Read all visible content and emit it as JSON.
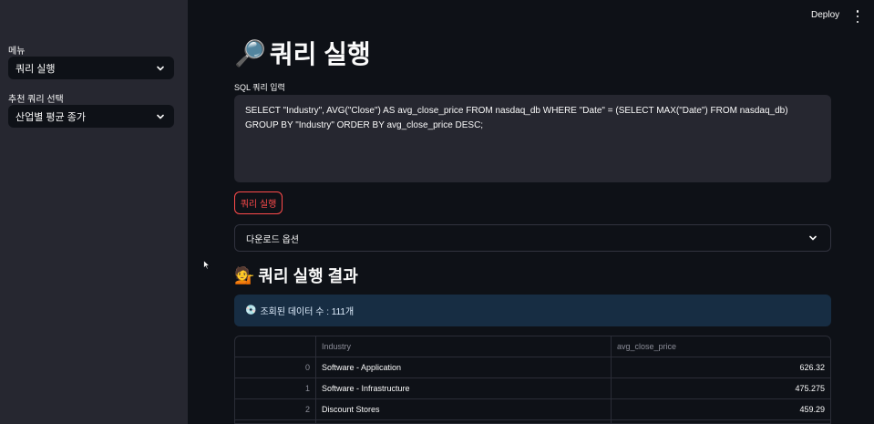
{
  "topbar": {
    "deploy_label": "Deploy"
  },
  "sidebar": {
    "menu_label": "메뉴",
    "menu_value": "쿼리 실행",
    "recommend_label": "추천 쿼리 선택",
    "recommend_value": "산업별 평균 종가"
  },
  "main": {
    "title_emoji": "🔎",
    "title": "쿼리 실행",
    "sql_label": "SQL 쿼리 입력",
    "sql_text": "SELECT \"Industry\", AVG(\"Close\") AS avg_close_price FROM nasdaq_db WHERE \"Date\" = (SELECT MAX(\"Date\") FROM nasdaq_db) GROUP BY \"Industry\" ORDER BY avg_close_price DESC;",
    "run_button": "쿼리 실행",
    "download_expander": "다운로드 옵션",
    "result_emoji": "💁",
    "result_title": "쿼리 실행 결과",
    "info_emoji": "💿",
    "info_text": "조회된 데이터 수 : 111개"
  },
  "table": {
    "columns": [
      "",
      "Industry",
      "avg_close_price"
    ],
    "rows": [
      [
        "0",
        "Software - Application",
        "626.32"
      ],
      [
        "1",
        "Software - Infrastructure",
        "475.275"
      ],
      [
        "2",
        "Discount Stores",
        "459.29"
      ],
      [
        "",
        "",
        ""
      ]
    ]
  },
  "colors": {
    "accent": "#ff4b4b",
    "info_bg": "#172d43",
    "sidebar_bg": "#262730",
    "app_bg": "#0e1117"
  }
}
